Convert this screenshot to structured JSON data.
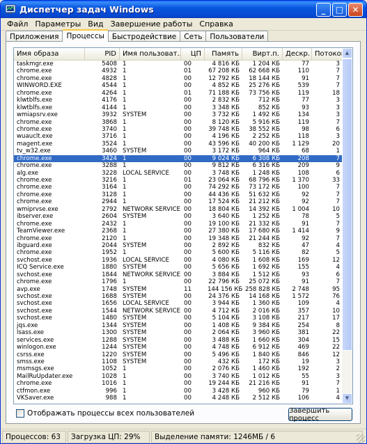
{
  "window": {
    "title": "Диспетчер задач Windows"
  },
  "menu": [
    "Файл",
    "Параметры",
    "Вид",
    "Завершение работы",
    "Справка"
  ],
  "tabs": [
    "Приложения",
    "Процессы",
    "Быстродействие",
    "Сеть",
    "Пользователи"
  ],
  "active_tab": "Процессы",
  "columns": [
    "Имя образа",
    "PID",
    "Имя пользоват...",
    "ЦП",
    "Память",
    "Вирт.п.",
    "Дескр.",
    "Потоков"
  ],
  "rows": [
    [
      "taskmgr.exe",
      "5408",
      "1",
      "00",
      "4 816 КБ",
      "1 204 КБ",
      "77",
      "3"
    ],
    [
      "chrome.exe",
      "4932",
      "1",
      "01",
      "67 208 КБ",
      "62 668 КБ",
      "110",
      "7"
    ],
    [
      "chrome.exe",
      "4828",
      "1",
      "00",
      "12 792 КБ",
      "18 144 КБ",
      "91",
      "7"
    ],
    [
      "WINWORD.EXE",
      "4544",
      "1",
      "00",
      "4 852 КБ",
      "25 276 КБ",
      "539",
      "7"
    ],
    [
      "chrome.exe",
      "4264",
      "1",
      "01",
      "71 188 КБ",
      "73 756 КБ",
      "119",
      "18"
    ],
    [
      "klwtblfs.exe",
      "4176",
      "1",
      "00",
      "2 832 КБ",
      "712 КБ",
      "77",
      "3"
    ],
    [
      "klwtblfs.exe",
      "4144",
      "1",
      "00",
      "3 348 КБ",
      "852 КБ",
      "93",
      "3"
    ],
    [
      "wmiapsrv.exe",
      "3932",
      "SYSTEM",
      "00",
      "3 732 КБ",
      "1 492 КБ",
      "134",
      "3"
    ],
    [
      "chrome.exe",
      "3868",
      "1",
      "00",
      "8 120 КБ",
      "5 916 КБ",
      "119",
      "7"
    ],
    [
      "chrome.exe",
      "3740",
      "1",
      "00",
      "39 748 КБ",
      "38 552 КБ",
      "98",
      "6"
    ],
    [
      "wuauclt.exe",
      "3716",
      "1",
      "00",
      "4 196 КБ",
      "2 252 КБ",
      "118",
      "3"
    ],
    [
      "magent.exe",
      "3524",
      "1",
      "00",
      "43 596 КБ",
      "40 200 КБ",
      "1 129",
      "20"
    ],
    [
      "tv_w32.exe",
      "3460",
      "SYSTEM",
      "00",
      "3 172 КБ",
      "964 КБ",
      "68",
      "1"
    ],
    [
      "chrome.exe",
      "3424",
      "1",
      "00",
      "9 024 КБ",
      "6 308 КБ",
      "208",
      "7"
    ],
    [
      "chrome.exe",
      "3288",
      "1",
      "00",
      "9 812 КБ",
      "6 316 КБ",
      "209",
      "9"
    ],
    [
      "alg.exe",
      "3228",
      "LOCAL SERVICE",
      "00",
      "3 748 КБ",
      "1 248 КБ",
      "108",
      "6"
    ],
    [
      "chrome.exe",
      "3216",
      "1",
      "01",
      "23 064 КБ",
      "68 796 КБ",
      "1 370",
      "33"
    ],
    [
      "chrome.exe",
      "3164",
      "1",
      "00",
      "74 292 КБ",
      "73 172 КБ",
      "100",
      "7"
    ],
    [
      "chrome.exe",
      "3128",
      "1",
      "00",
      "44 436 КБ",
      "51 632 КБ",
      "92",
      "7"
    ],
    [
      "chrome.exe",
      "2944",
      "1",
      "00",
      "17 524 КБ",
      "21 212 КБ",
      "92",
      "7"
    ],
    [
      "wmiprvse.exe",
      "2792",
      "NETWORK SERVICE",
      "00",
      "18 804 КБ",
      "14 392 КБ",
      "1 004",
      "10"
    ],
    [
      "ibserver.exe",
      "2604",
      "SYSTEM",
      "00",
      "3 640 КБ",
      "1 252 КБ",
      "78",
      "5"
    ],
    [
      "chrome.exe",
      "2432",
      "1",
      "00",
      "19 100 КБ",
      "21 332 КБ",
      "91",
      "7"
    ],
    [
      "TeamViewer.exe",
      "2368",
      "1",
      "00",
      "27 380 КБ",
      "17 680 КБ",
      "1 414",
      "9"
    ],
    [
      "chrome.exe",
      "2120",
      "1",
      "00",
      "19 348 КБ",
      "21 244 КБ",
      "92",
      "7"
    ],
    [
      "ibguard.exe",
      "2044",
      "SYSTEM",
      "00",
      "2 892 КБ",
      "832 КБ",
      "47",
      "4"
    ],
    [
      "chrome.exe",
      "1952",
      "1",
      "00",
      "5 600 КБ",
      "5 116 КБ",
      "82",
      "5"
    ],
    [
      "svchost.exe",
      "1936",
      "LOCAL SERVICE",
      "00",
      "4 080 КБ",
      "1 608 КБ",
      "169",
      "12"
    ],
    [
      "ICQ Service.exe",
      "1880",
      "SYSTEM",
      "00",
      "5 656 КБ",
      "1 692 КБ",
      "155",
      "4"
    ],
    [
      "svchost.exe",
      "1844",
      "NETWORK SERVICE",
      "00",
      "3 884 КБ",
      "1 512 КБ",
      "93",
      "6"
    ],
    [
      "chrome.exe",
      "1796",
      "1",
      "00",
      "22 796 КБ",
      "25 072 КБ",
      "91",
      "7"
    ],
    [
      "avp.exe",
      "1748",
      "SYSTEM",
      "11",
      "144 156 КБ",
      "258 828 КБ",
      "2 748",
      "95"
    ],
    [
      "svchost.exe",
      "1688",
      "SYSTEM",
      "00",
      "24 376 КБ",
      "14 168 КБ",
      "1 572",
      "76"
    ],
    [
      "svchost.exe",
      "1656",
      "LOCAL SERVICE",
      "00",
      "3 944 КБ",
      "1 360 КБ",
      "109",
      "4"
    ],
    [
      "svchost.exe",
      "1544",
      "NETWORK SERVICE",
      "00",
      "4 712 КБ",
      "2 016 КБ",
      "357",
      "10"
    ],
    [
      "svchost.exe",
      "1480",
      "SYSTEM",
      "00",
      "5 104 КБ",
      "3 108 КБ",
      "217",
      "17"
    ],
    [
      "jqs.exe",
      "1344",
      "SYSTEM",
      "00",
      "1 408 КБ",
      "9 384 КБ",
      "254",
      "8"
    ],
    [
      "lsass.exe",
      "1300",
      "SYSTEM",
      "00",
      "2 064 КБ",
      "3 960 КБ",
      "381",
      "22"
    ],
    [
      "services.exe",
      "1288",
      "SYSTEM",
      "00",
      "3 488 КБ",
      "1 660 КБ",
      "304",
      "15"
    ],
    [
      "winlogon.exe",
      "1244",
      "SYSTEM",
      "00",
      "4 748 КБ",
      "6 912 КБ",
      "469",
      "22"
    ],
    [
      "csrss.exe",
      "1220",
      "SYSTEM",
      "00",
      "5 496 КБ",
      "1 840 КБ",
      "846",
      "12"
    ],
    [
      "smss.exe",
      "1108",
      "SYSTEM",
      "00",
      "432 КБ",
      "172 КБ",
      "19",
      "3"
    ],
    [
      "msmsgs.exe",
      "1052",
      "1",
      "00",
      "2 076 КБ",
      "1 460 КБ",
      "192",
      "2"
    ],
    [
      "MailRuUpdater.exe",
      "1028",
      "1",
      "00",
      "3 740 КБ",
      "1 012 КБ",
      "55",
      "3"
    ],
    [
      "chrome.exe",
      "1016",
      "1",
      "00",
      "19 244 КБ",
      "21 216 КБ",
      "91",
      "7"
    ],
    [
      "ctfmon.exe",
      "996",
      "1",
      "00",
      "3 428 КБ",
      "960 КБ",
      "79",
      "1"
    ],
    [
      "VKSaver.exe",
      "988",
      "1",
      "00",
      "4 248 КБ",
      "2 512 КБ",
      "106",
      "4"
    ]
  ],
  "selected_pid": "3424",
  "show_all_users_label": "Отображать процессы всех пользователей",
  "end_process_label": "Завершить процесс",
  "status": {
    "processes": "Процессов: 63",
    "cpu": "Загрузка ЦП: 29%",
    "commit": "Выделение памяти: 1246МБ / 6"
  }
}
